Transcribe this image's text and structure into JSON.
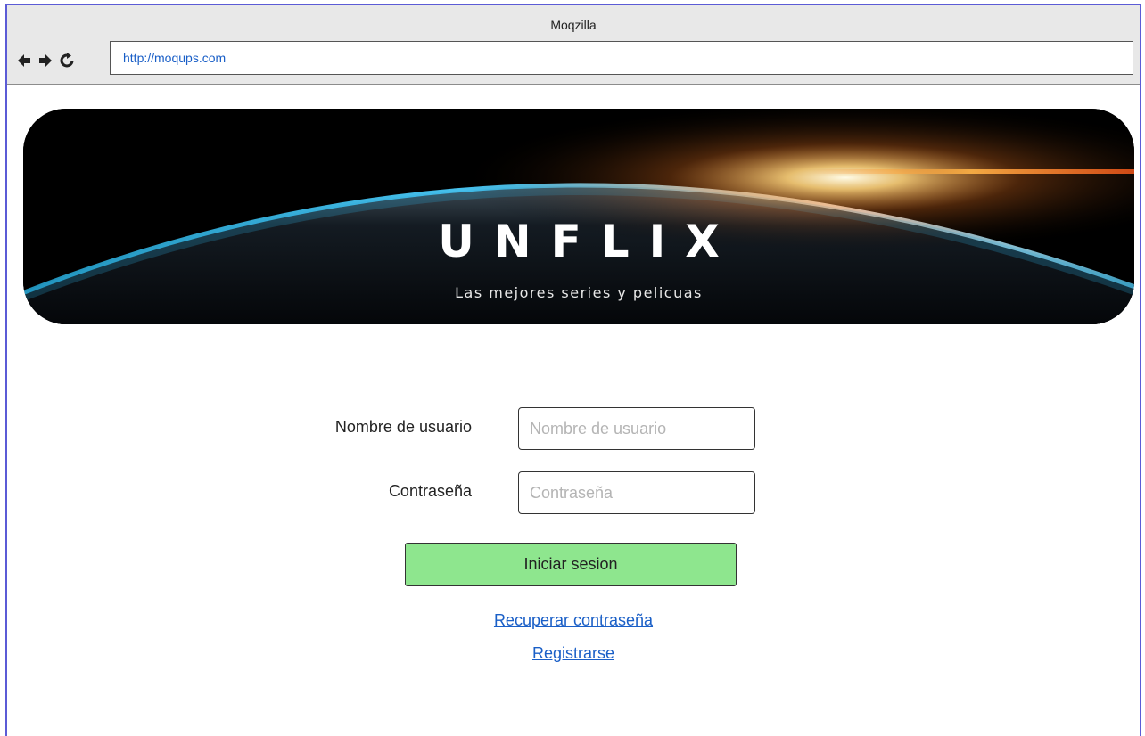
{
  "browser": {
    "title": "Moqzilla",
    "url": "http://moqups.com"
  },
  "banner": {
    "brand": "UNFLIX",
    "tagline": "Las mejores series y pelicuas"
  },
  "login": {
    "username_label": "Nombre de usuario",
    "username_placeholder": "Nombre de usuario",
    "password_label": "Contraseña",
    "password_placeholder": "Contraseña",
    "submit_label": "Iniciar sesion",
    "recover_link": "Recuperar contraseña",
    "register_link": "Registrarse"
  },
  "colors": {
    "window_border": "#5b5bd6",
    "button_green": "#8ee68e",
    "link_blue": "#1a5fc7"
  },
  "icons": [
    "back-arrow-icon",
    "forward-arrow-icon",
    "reload-icon"
  ]
}
